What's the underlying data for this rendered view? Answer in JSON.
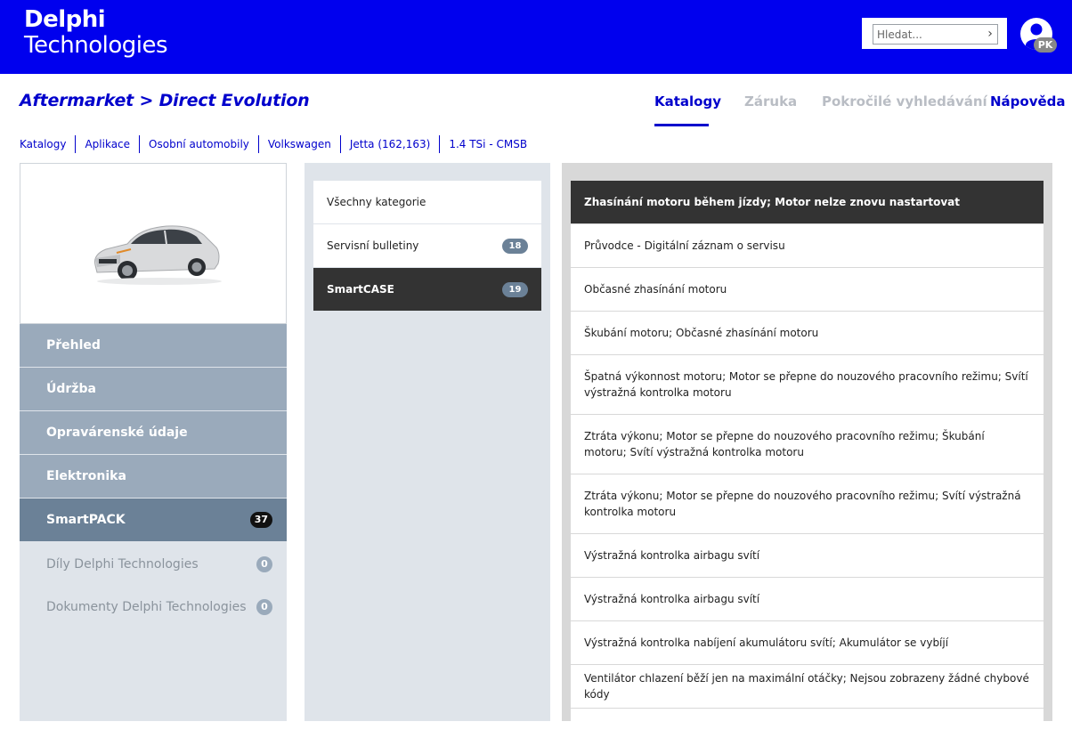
{
  "brand": {
    "line1": "Delphi",
    "line2": "Technologies"
  },
  "search": {
    "placeholder": "Hledat...",
    "arrow": "›"
  },
  "user": {
    "initials": "PK"
  },
  "page_title": "Aftermarket > Direct Evolution",
  "tabs": [
    {
      "label": "Katalogy",
      "state": "active"
    },
    {
      "label": "Záruka",
      "state": "disabled"
    },
    {
      "label": "Pokročilé vyhledávání",
      "state": "disabled"
    },
    {
      "label": "Nápověda",
      "state": "link"
    }
  ],
  "breadcrumb": [
    "Katalogy",
    "Aplikace",
    "Osobní automobily",
    "Volkswagen",
    "Jetta (162,163)",
    "1.4 TSi - CMSB"
  ],
  "left_nav": [
    {
      "label": "Přehled"
    },
    {
      "label": "Údržba"
    },
    {
      "label": "Opravárenské údaje"
    },
    {
      "label": "Elektronika"
    },
    {
      "label": "SmartPACK",
      "badge": "37"
    },
    {
      "label": "Díly Delphi Technologies",
      "badge": "0"
    },
    {
      "label": "Dokumenty Delphi Technologies",
      "badge": "0"
    }
  ],
  "categories": [
    {
      "label": "Všechny kategorie"
    },
    {
      "label": "Servisní bulletiny",
      "badge": "18"
    },
    {
      "label": "SmartCASE",
      "badge": "19"
    }
  ],
  "cases": [
    "Zhasínání motoru během jízdy; Motor nelze znovu nastartovat",
    "Průvodce - Digitální záznam o servisu",
    "Občasné zhasínání motoru",
    "Škubání motoru; Občasné zhasínání motoru",
    "Špatná výkonnost motoru; Motor se přepne do nouzového pracovního režimu; Svítí výstražná kontrolka motoru",
    "Ztráta výkonu; Motor se přepne do nouzového pracovního režimu; Škubání motoru; Svítí výstražná kontrolka motoru",
    "Ztráta výkonu; Motor se přepne do nouzového pracovního režimu; Svítí výstražná kontrolka motoru",
    "Výstražná kontrolka airbagu svítí",
    "Výstražná kontrolka airbagu svítí",
    "Výstražná kontrolka nabíjení akumulátoru svítí; Akumulátor se vybíjí",
    "Ventilátor chlazení běží jen na maximální otáčky; Nejsou zobrazeny žádné chybové kódy",
    ""
  ],
  "colors": {
    "header_blue": "#0000ee",
    "link_blue": "#0000cc",
    "nav_slate": "#9aaabb",
    "nav_active": "#6b8197",
    "dark": "#333333"
  }
}
